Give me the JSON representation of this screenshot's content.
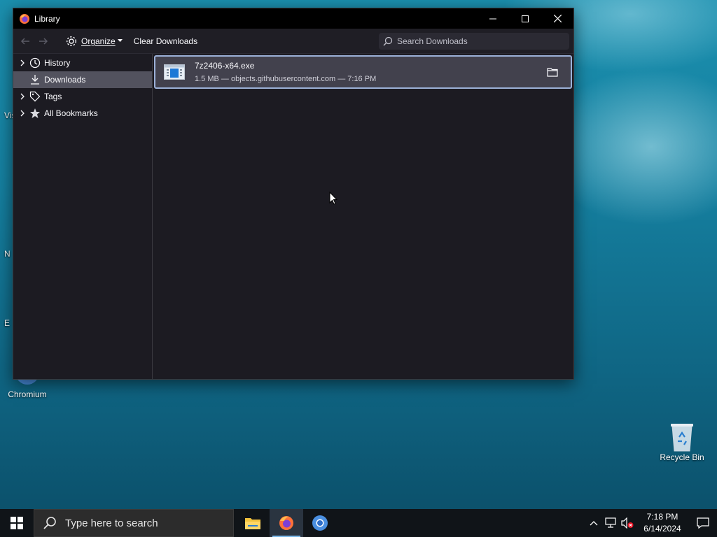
{
  "window": {
    "title": "Library",
    "controls": [
      "minimize",
      "maximize",
      "close"
    ]
  },
  "toolbar": {
    "organize_label": "Organize",
    "clear_label": "Clear Downloads",
    "search_placeholder": "Search Downloads"
  },
  "sidebar": {
    "items": [
      {
        "label": "History",
        "icon": "clock-icon",
        "expandable": true,
        "selected": false
      },
      {
        "label": "Downloads",
        "icon": "download-icon",
        "expandable": false,
        "selected": true
      },
      {
        "label": "Tags",
        "icon": "tag-icon",
        "expandable": true,
        "selected": false
      },
      {
        "label": "All Bookmarks",
        "icon": "star-icon",
        "expandable": true,
        "selected": false
      }
    ]
  },
  "downloads": [
    {
      "filename": "7z2406-x64.exe",
      "details": "1.5 MB — objects.githubusercontent.com — 7:16 PM"
    }
  ],
  "desktop": {
    "icons": [
      {
        "label": "Chromium"
      },
      {
        "label": "Recycle Bin"
      }
    ],
    "edge_labels": [
      "Vis",
      "N",
      "E"
    ]
  },
  "taskbar": {
    "search_placeholder": "Type here to search",
    "apps": [
      "file-explorer",
      "firefox",
      "chromium"
    ],
    "time": "7:18 PM",
    "date": "6/14/2024"
  },
  "colors": {
    "window_bg": "#1c1b22",
    "selected_item": "#52525e",
    "download_row": "#42414d",
    "focus_ring": "#9cb1d8"
  }
}
